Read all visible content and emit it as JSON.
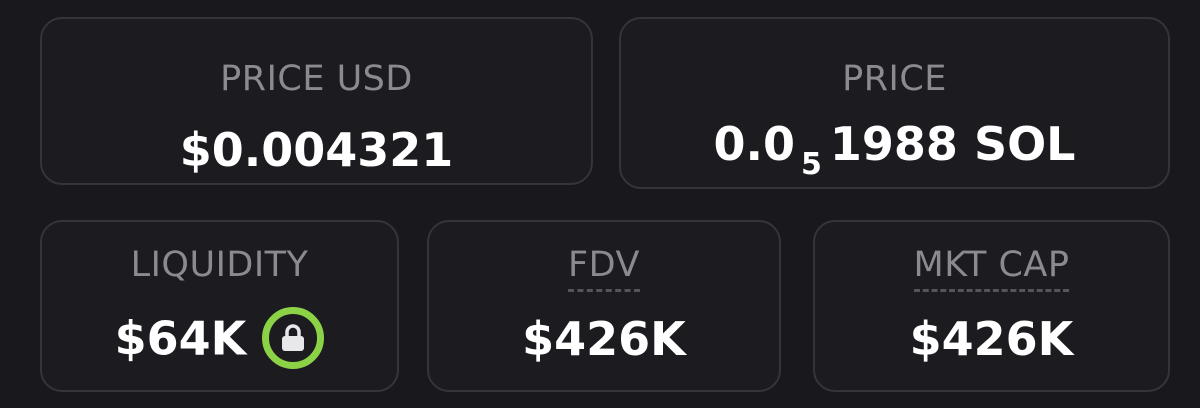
{
  "cards": {
    "price_usd": {
      "label": "PRICE USD",
      "value": "$0.004321"
    },
    "price_sol": {
      "label": "PRICE",
      "prefix": "0.0",
      "zero_count": "5",
      "digits": "1988",
      "unit": "SOL"
    },
    "liquidity": {
      "label": "LIQUIDITY",
      "value": "$64K",
      "icon": "lock-icon"
    },
    "fdv": {
      "label": "FDV",
      "value": "$426K"
    },
    "mkt_cap": {
      "label": "MKT CAP",
      "value": "$426K"
    }
  },
  "colors": {
    "background": "#19191d",
    "card_border": "#34343a",
    "label": "#8a8a90",
    "value": "#ffffff",
    "lock_ring": "#8bd246"
  }
}
